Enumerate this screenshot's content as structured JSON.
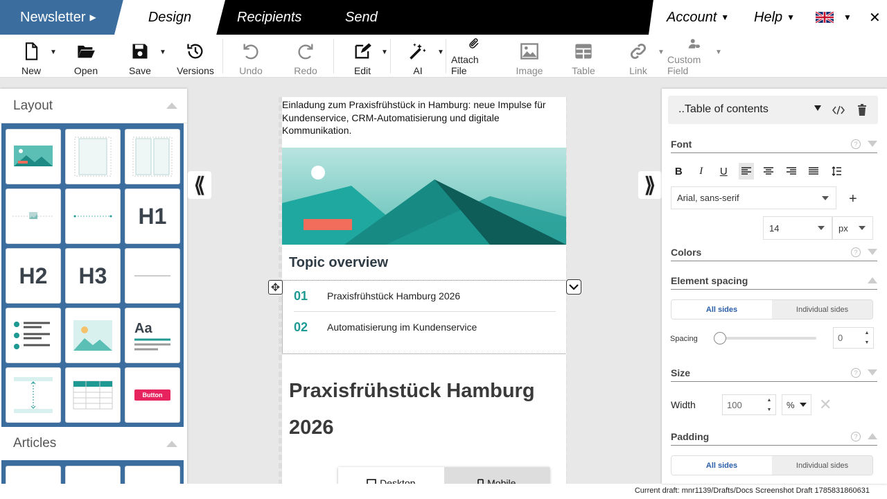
{
  "nav": {
    "newsletter": "Newsletter",
    "design": "Design",
    "recipients": "Recipients",
    "send": "Send",
    "account": "Account",
    "help": "Help",
    "close": "✕"
  },
  "toolbar": {
    "new": "New",
    "open": "Open",
    "save": "Save",
    "versions": "Versions",
    "undo": "Undo",
    "redo": "Redo",
    "edit": "Edit",
    "ai": "AI",
    "attach": "Attach File",
    "image": "Image",
    "table": "Table",
    "link": "Link",
    "custom_field": "Custom Field"
  },
  "left_panel": {
    "layout_title": "Layout",
    "articles_title": "Articles",
    "tiles": {
      "h1": "H1",
      "h2": "H2",
      "h3": "H3",
      "text_sample": "Aa",
      "button": "Button"
    }
  },
  "email": {
    "intro": "Einladung zum Praxisfrühstück in Hamburg: neue Impulse für Kundenservice, CRM-Automatisierung und digitale Kommunikation.",
    "topic_title": "Topic overview",
    "toc": [
      {
        "num": "01",
        "text": "Praxisfrühstück Hamburg 2026"
      },
      {
        "num": "02",
        "text": "Automatisierung im Kundenservice"
      }
    ],
    "big_title": "Praxisfrühstück Hamburg 2026"
  },
  "device": {
    "desktop": "Desktop",
    "mobile": "Mobile"
  },
  "status": "Current draft: mnr1139/Drafts/Docs Screenshot Draft 1785831860631",
  "right_panel": {
    "element": "..Table of contents",
    "font_section": "Font",
    "font_family": "Arial, sans-serif",
    "font_size": "14",
    "font_unit": "px",
    "colors_section": "Colors",
    "spacing_section": "Element spacing",
    "all_sides": "All sides",
    "individual_sides": "Individual sides",
    "spacing_label": "Spacing",
    "spacing_value": "0",
    "size_section": "Size",
    "width_label": "Width",
    "width_value": "100",
    "width_unit": "%",
    "padding_section": "Padding"
  },
  "colors": {
    "brand_blue": "#3b6d9e",
    "teal": "#1e9a93",
    "accent_orange": "#f26d5b"
  }
}
